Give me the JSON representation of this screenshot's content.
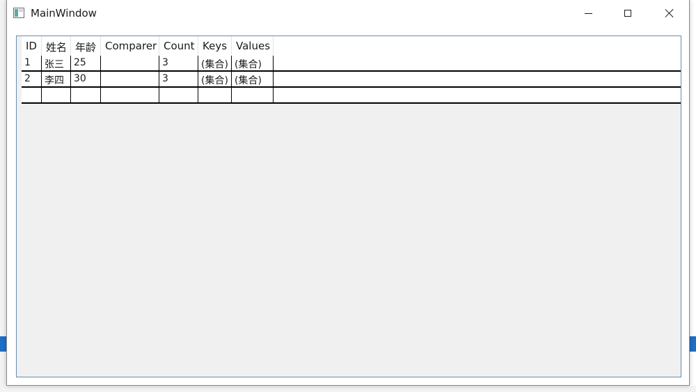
{
  "window": {
    "title": "MainWindow"
  },
  "grid": {
    "columns": [
      "ID",
      "姓名",
      "年龄",
      "Comparer",
      "Count",
      "Keys",
      "Values"
    ],
    "rows": [
      {
        "id": "1",
        "name": "张三",
        "age": "25",
        "comparer": "",
        "count": "3",
        "keys": "(集合)",
        "values": "(集合)"
      },
      {
        "id": "2",
        "name": "李四",
        "age": "30",
        "comparer": "",
        "count": "3",
        "keys": "(集合)",
        "values": "(集合)"
      },
      {
        "id": "",
        "name": "",
        "age": "",
        "comparer": "",
        "count": "",
        "keys": "",
        "values": ""
      }
    ]
  },
  "icons": {
    "app": "app-window-icon",
    "minimize": "minimize-icon",
    "maximize": "maximize-icon",
    "close": "close-icon"
  },
  "colors": {
    "grid_border": "#688caf",
    "grid_background": "#f0f0f0"
  }
}
